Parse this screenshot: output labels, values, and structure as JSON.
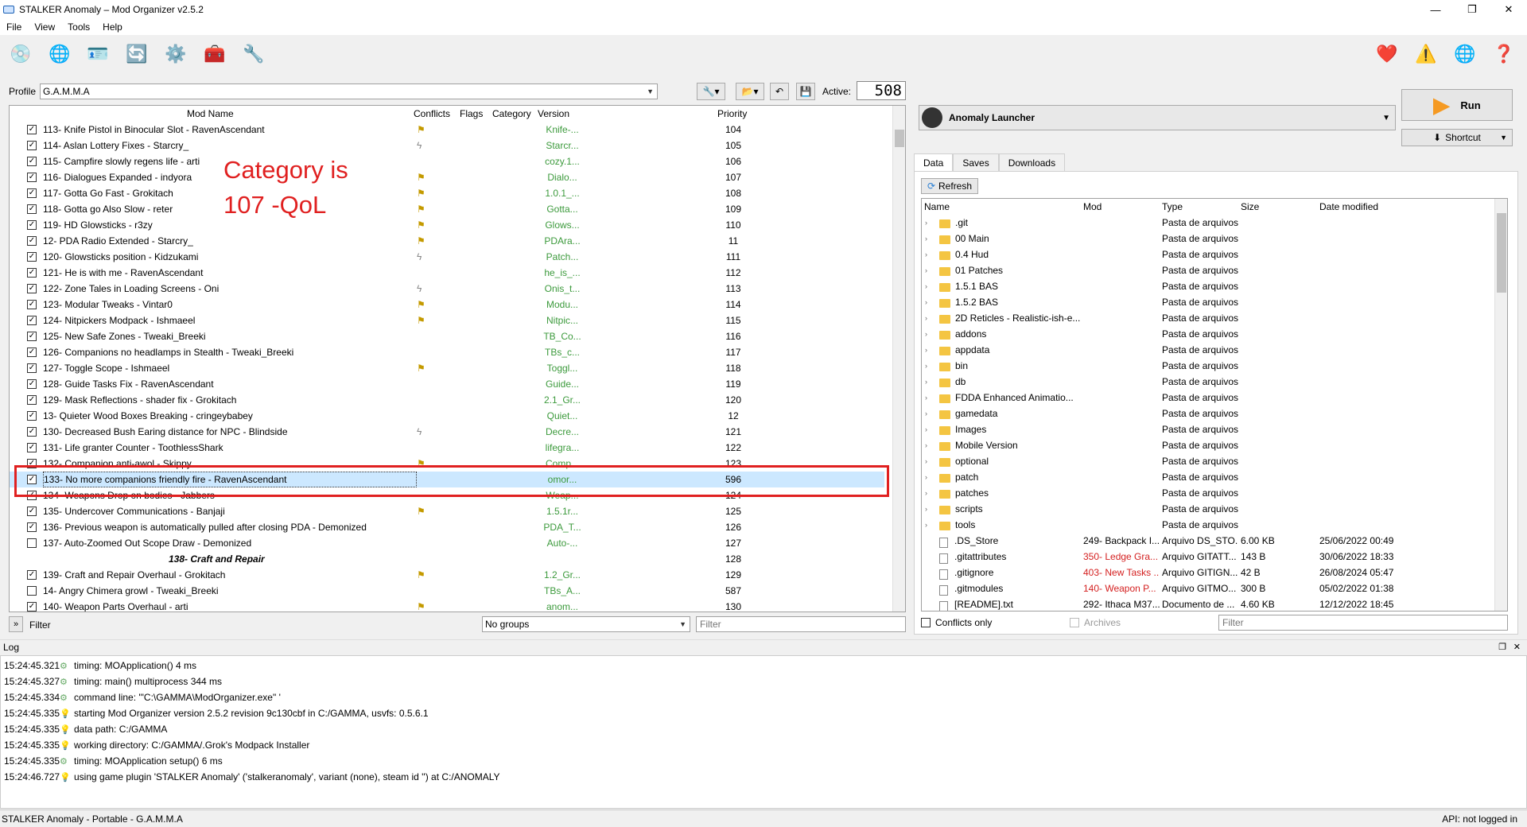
{
  "window": {
    "title": "STALKER Anomaly – Mod Organizer v2.5.2",
    "controls": [
      "—",
      "❐",
      "✕"
    ]
  },
  "menu": [
    "File",
    "View",
    "Tools",
    "Help"
  ],
  "profile": {
    "label": "Profile",
    "value": "G.A.M.M.A",
    "active_label": "Active:",
    "active_count": "508"
  },
  "columns": {
    "name": "Mod Name",
    "conflicts": "Conflicts",
    "flags": "Flags",
    "category": "Category",
    "version": "Version",
    "priority": "Priority"
  },
  "mods": [
    {
      "name": "113- Knife Pistol in Binocular Slot - RavenAscendant",
      "conf": "flag",
      "ver": "Knife-...",
      "pri": "104",
      "chk": true
    },
    {
      "name": "114- Aslan Lottery Fixes - Starcry_",
      "conf": "bolt",
      "ver": "Starcr...",
      "pri": "105",
      "chk": true
    },
    {
      "name": "115- Campfire slowly regens life - arti",
      "conf": "",
      "ver": "cozy.1...",
      "pri": "106",
      "chk": true
    },
    {
      "name": "116- Dialogues Expanded - indyora",
      "conf": "flag",
      "ver": "Dialo...",
      "pri": "107",
      "chk": true
    },
    {
      "name": "117- Gotta Go Fast - Grokitach",
      "conf": "flag",
      "ver": "1.0.1_...",
      "pri": "108",
      "chk": true
    },
    {
      "name": "118- Gotta go Also Slow - reter",
      "conf": "flag",
      "ver": "Gotta...",
      "pri": "109",
      "chk": true
    },
    {
      "name": "119- HD Glowsticks - r3zy",
      "conf": "flag",
      "ver": "Glows...",
      "pri": "110",
      "chk": true
    },
    {
      "name": "12- PDA Radio Extended - Starcry_",
      "conf": "flag",
      "ver": "PDAra...",
      "pri": "11",
      "chk": true
    },
    {
      "name": "120- Glowsticks position - Kidzukami",
      "conf": "bolt",
      "ver": "Patch...",
      "pri": "111",
      "chk": true
    },
    {
      "name": "121- He is with me - RavenAscendant",
      "conf": "",
      "ver": "he_is_...",
      "pri": "112",
      "chk": true
    },
    {
      "name": "122- Zone Tales in Loading Screens - Oni",
      "conf": "bolt",
      "ver": "Onis_t...",
      "pri": "113",
      "chk": true
    },
    {
      "name": "123- Modular Tweaks - Vintar0",
      "conf": "flag",
      "ver": "Modu...",
      "pri": "114",
      "chk": true
    },
    {
      "name": "124- Nitpickers Modpack - Ishmaeel",
      "conf": "flag",
      "ver": "Nitpic...",
      "pri": "115",
      "chk": true
    },
    {
      "name": "125- New Safe Zones - Tweaki_Breeki",
      "conf": "",
      "ver": "TB_Co...",
      "pri": "116",
      "chk": true
    },
    {
      "name": "126- Companions no headlamps in Stealth - Tweaki_Breeki",
      "conf": "",
      "ver": "TBs_c...",
      "pri": "117",
      "chk": true
    },
    {
      "name": "127- Toggle Scope - Ishmaeel",
      "conf": "flag",
      "ver": "Toggl...",
      "pri": "118",
      "chk": true
    },
    {
      "name": "128- Guide Tasks Fix - RavenAscendant",
      "conf": "",
      "ver": "Guide...",
      "pri": "119",
      "chk": true
    },
    {
      "name": "129- Mask Reflections - shader fix - Grokitach",
      "conf": "",
      "ver": "2.1_Gr...",
      "pri": "120",
      "chk": true
    },
    {
      "name": "13- Quieter Wood Boxes Breaking - cringeybabey",
      "conf": "",
      "ver": "Quiet...",
      "pri": "12",
      "chk": true
    },
    {
      "name": "130- Decreased Bush Earing distance for NPC - Blindside",
      "conf": "bolt",
      "ver": "Decre...",
      "pri": "121",
      "chk": true
    },
    {
      "name": "131- Life granter Counter - ToothlessShark",
      "conf": "",
      "ver": "lifegra...",
      "pri": "122",
      "chk": true
    },
    {
      "name": "132- Companion anti-awol - Skippy",
      "conf": "flag",
      "ver": "Comp...",
      "pri": "123",
      "chk": true
    },
    {
      "name": "133- No more companions friendly fire - RavenAscendant",
      "conf": "",
      "ver": "omor...",
      "pri": "596",
      "chk": true,
      "sel": true
    },
    {
      "name": "134- Weapons Drop on bodies - Jabbers",
      "conf": "",
      "ver": "Weap...",
      "pri": "124",
      "chk": true
    },
    {
      "name": "135- Undercover Communications - Banjaji",
      "conf": "flag",
      "ver": "1.5.1r...",
      "pri": "125",
      "chk": true
    },
    {
      "name": "136- Previous weapon is automatically pulled after closing PDA - Demonized",
      "conf": "",
      "ver": "PDA_T...",
      "pri": "126",
      "chk": true
    },
    {
      "name": "137- Auto-Zoomed Out Scope Draw - Demonized",
      "conf": "",
      "ver": "Auto-...",
      "pri": "127",
      "chk": false
    },
    {
      "name": "138- Craft and Repair",
      "conf": "",
      "ver": "",
      "pri": "128",
      "sep": true
    },
    {
      "name": "139- Craft and Repair Overhaul - Grokitach",
      "conf": "flag",
      "ver": "1.2_Gr...",
      "pri": "129",
      "chk": true
    },
    {
      "name": "14- Angry Chimera growl - Tweaki_Breeki",
      "conf": "",
      "ver": "TBs_A...",
      "pri": "587",
      "chk": false
    },
    {
      "name": "140- Weapon Parts Overhaul - arti",
      "conf": "flag",
      "ver": "anom...",
      "pri": "130",
      "chk": true
    }
  ],
  "annotation": {
    "line1": "Category is",
    "line2": "107 -QoL"
  },
  "bottom_left": {
    "filter_label": "Filter",
    "groups": "No groups",
    "filter_placeholder": "Filter",
    "expand": "»"
  },
  "executable": {
    "name": "Anomaly Launcher",
    "run": "Run",
    "shortcut": "Shortcut"
  },
  "right_tabs": [
    "Data",
    "Saves",
    "Downloads"
  ],
  "refresh": "Refresh",
  "data_columns": {
    "name": "Name",
    "mod": "Mod",
    "type": "Type",
    "size": "Size",
    "date": "Date modified"
  },
  "data_rows": [
    {
      "name": ".git",
      "type": "Pasta de arquivos",
      "folder": true
    },
    {
      "name": "00 Main",
      "type": "Pasta de arquivos",
      "folder": true
    },
    {
      "name": "0.4 Hud",
      "type": "Pasta de arquivos",
      "folder": true
    },
    {
      "name": "01 Patches",
      "type": "Pasta de arquivos",
      "folder": true
    },
    {
      "name": "1.5.1 BAS",
      "type": "Pasta de arquivos",
      "folder": true
    },
    {
      "name": "1.5.2 BAS",
      "type": "Pasta de arquivos",
      "folder": true
    },
    {
      "name": "2D Reticles - Realistic-ish-e...",
      "type": "Pasta de arquivos",
      "folder": true
    },
    {
      "name": "addons",
      "type": "Pasta de arquivos",
      "folder": true
    },
    {
      "name": "appdata",
      "type": "Pasta de arquivos",
      "folder": true
    },
    {
      "name": "bin",
      "type": "Pasta de arquivos",
      "folder": true
    },
    {
      "name": "db",
      "type": "Pasta de arquivos",
      "folder": true
    },
    {
      "name": "FDDA Enhanced Animatio...",
      "type": "Pasta de arquivos",
      "folder": true
    },
    {
      "name": "gamedata",
      "type": "Pasta de arquivos",
      "folder": true
    },
    {
      "name": "Images",
      "type": "Pasta de arquivos",
      "folder": true
    },
    {
      "name": "Mobile Version",
      "type": "Pasta de arquivos",
      "folder": true
    },
    {
      "name": "optional",
      "type": "Pasta de arquivos",
      "folder": true
    },
    {
      "name": "patch",
      "type": "Pasta de arquivos",
      "folder": true
    },
    {
      "name": "patches",
      "type": "Pasta de arquivos",
      "folder": true
    },
    {
      "name": "scripts",
      "type": "Pasta de arquivos",
      "folder": true
    },
    {
      "name": "tools",
      "type": "Pasta de arquivos",
      "folder": true
    },
    {
      "name": ".DS_Store",
      "mod": "249- Backpack I...",
      "type": "Arquivo DS_STO...",
      "size": "6.00 KB",
      "date": "25/06/2022 00:49"
    },
    {
      "name": ".gitattributes",
      "mod": "350- Ledge Gra...",
      "type": "Arquivo GITATT...",
      "size": "143 B",
      "date": "30/06/2022 18:33",
      "red": true
    },
    {
      "name": ".gitignore",
      "mod": "403- New Tasks ...",
      "type": "Arquivo GITIGN...",
      "size": "42 B",
      "date": "26/08/2024 05:47",
      "red": true
    },
    {
      "name": ".gitmodules",
      "mod": "140- Weapon P...",
      "type": "Arquivo GITMO...",
      "size": "300 B",
      "date": "05/02/2022 01:38",
      "red": true
    },
    {
      "name": "[README].txt",
      "mod": "292- Ithaca M37...",
      "type": "Documento de ...",
      "size": "4.60 KB",
      "date": "12/12/2022 18:45"
    }
  ],
  "conflicts_only": "Conflicts only",
  "archives": "Archives",
  "data_filter_placeholder": "Filter",
  "log": {
    "title": "Log",
    "lines": [
      {
        "t": "15:24:45.321",
        "m": "timing: MOApplication() 4 ms"
      },
      {
        "t": "15:24:45.327",
        "m": "timing: main() multiprocess 344 ms"
      },
      {
        "t": "15:24:45.334",
        "m": "command line: '\"C:\\GAMMA\\ModOrganizer.exe\" '"
      },
      {
        "t": "15:24:45.335",
        "m": "starting Mod Organizer version 2.5.2 revision 9c130cbf in C:/GAMMA, usvfs: 0.5.6.1"
      },
      {
        "t": "15:24:45.335",
        "m": "data path: C:/GAMMA"
      },
      {
        "t": "15:24:45.335",
        "m": "working directory: C:/GAMMA/.Grok's Modpack Installer"
      },
      {
        "t": "15:24:45.335",
        "m": "timing: MOApplication setup() 6 ms"
      },
      {
        "t": "15:24:46.727",
        "m": "using game plugin 'STALKER Anomaly' ('stalkeranomaly', variant (none), steam id '') at C:/ANOMALY"
      }
    ]
  },
  "status": {
    "left": "STALKER Anomaly - Portable - G.A.M.M.A",
    "right": "API: not logged in"
  },
  "colors": {
    "highlight": "#e02020",
    "selection": "#cce8ff",
    "version_green": "#3c9a3c"
  }
}
